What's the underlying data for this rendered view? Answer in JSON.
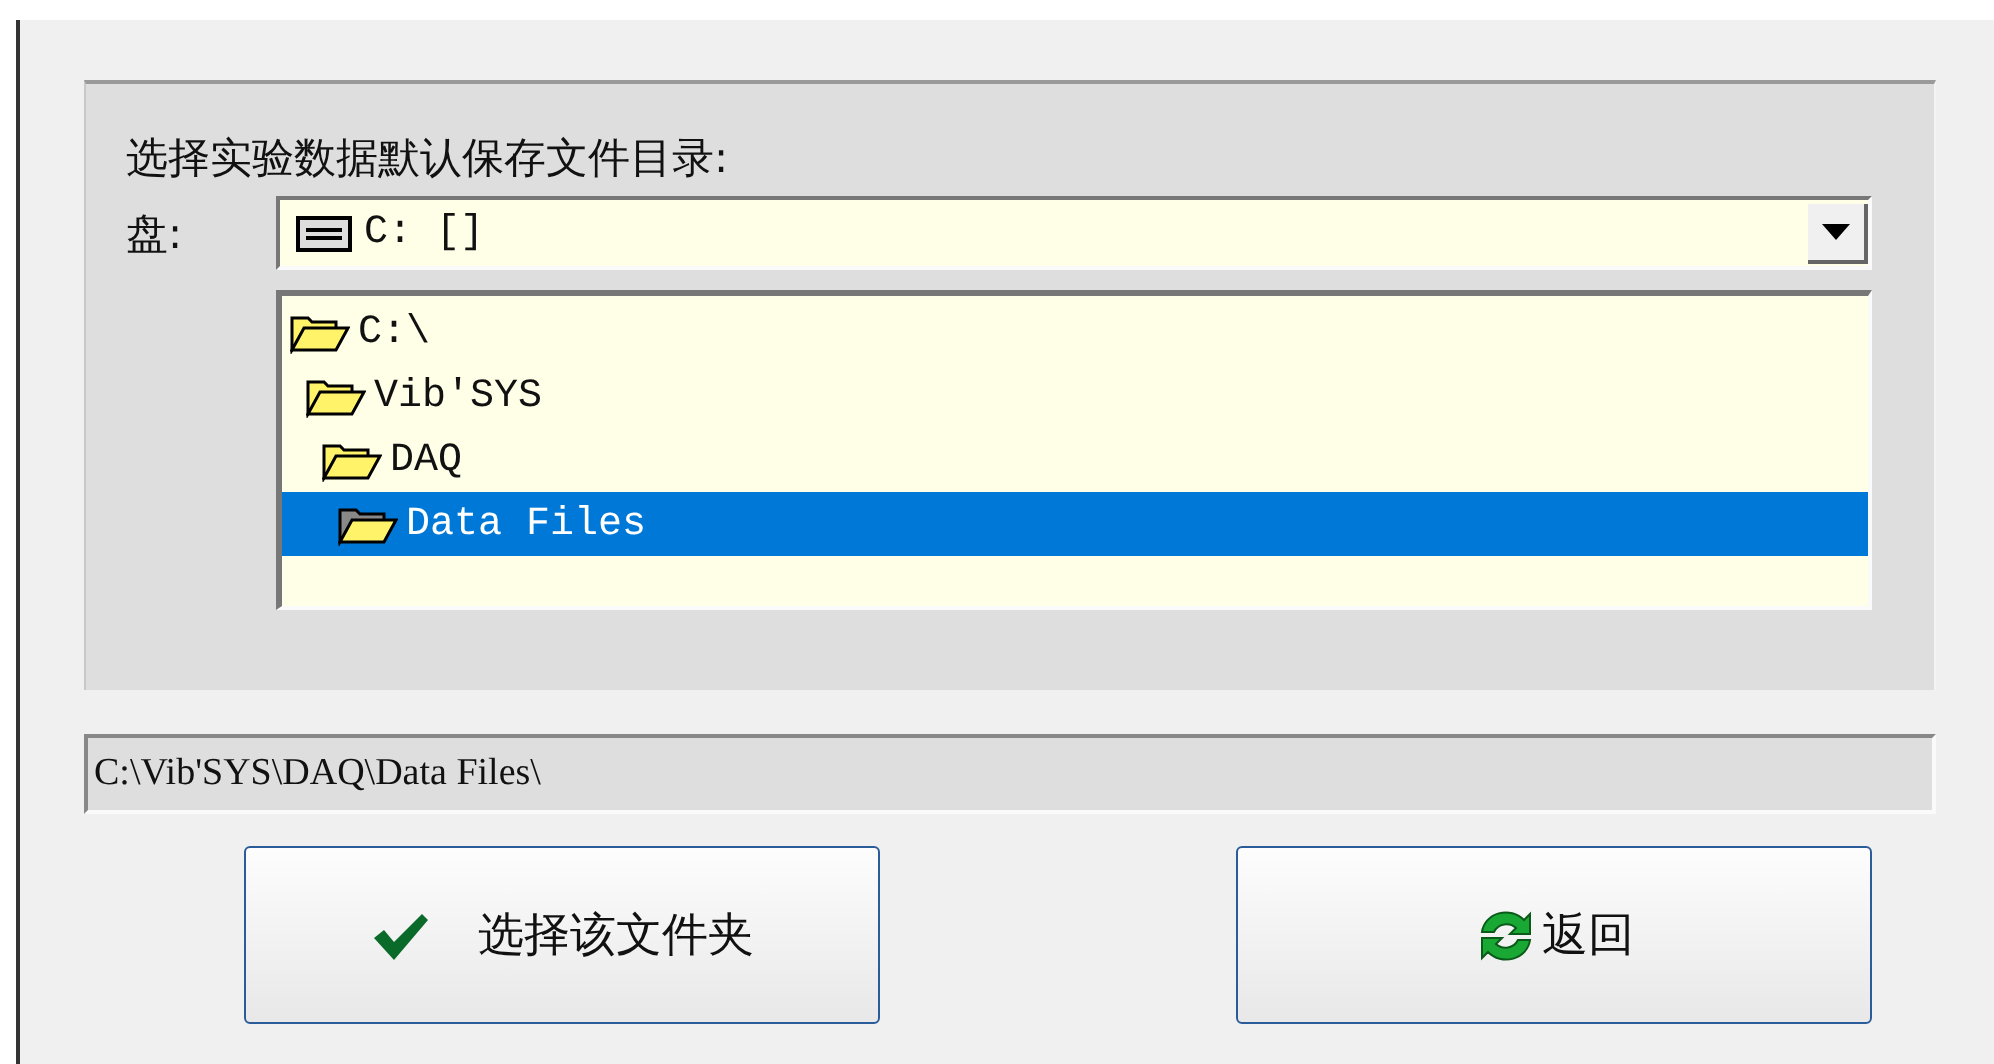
{
  "group": {
    "label": "选择实验数据默认保存文件目录:",
    "drive_label": "盘:",
    "drive": {
      "value": "C: []"
    },
    "tree": [
      {
        "label": "C:\\",
        "selected": false,
        "children": [
          {
            "label": "Vib'SYS",
            "selected": false,
            "children": [
              {
                "label": "DAQ",
                "selected": false,
                "children": [
                  {
                    "label": "Data Files",
                    "selected": true
                  }
                ]
              }
            ]
          }
        ]
      }
    ]
  },
  "path": {
    "value": "C:\\Vib'SYS\\DAQ\\Data Files\\"
  },
  "buttons": [
    {
      "kind": "confirm",
      "label": "选择该文件夹"
    },
    {
      "kind": "back",
      "label": "返回"
    }
  ]
}
